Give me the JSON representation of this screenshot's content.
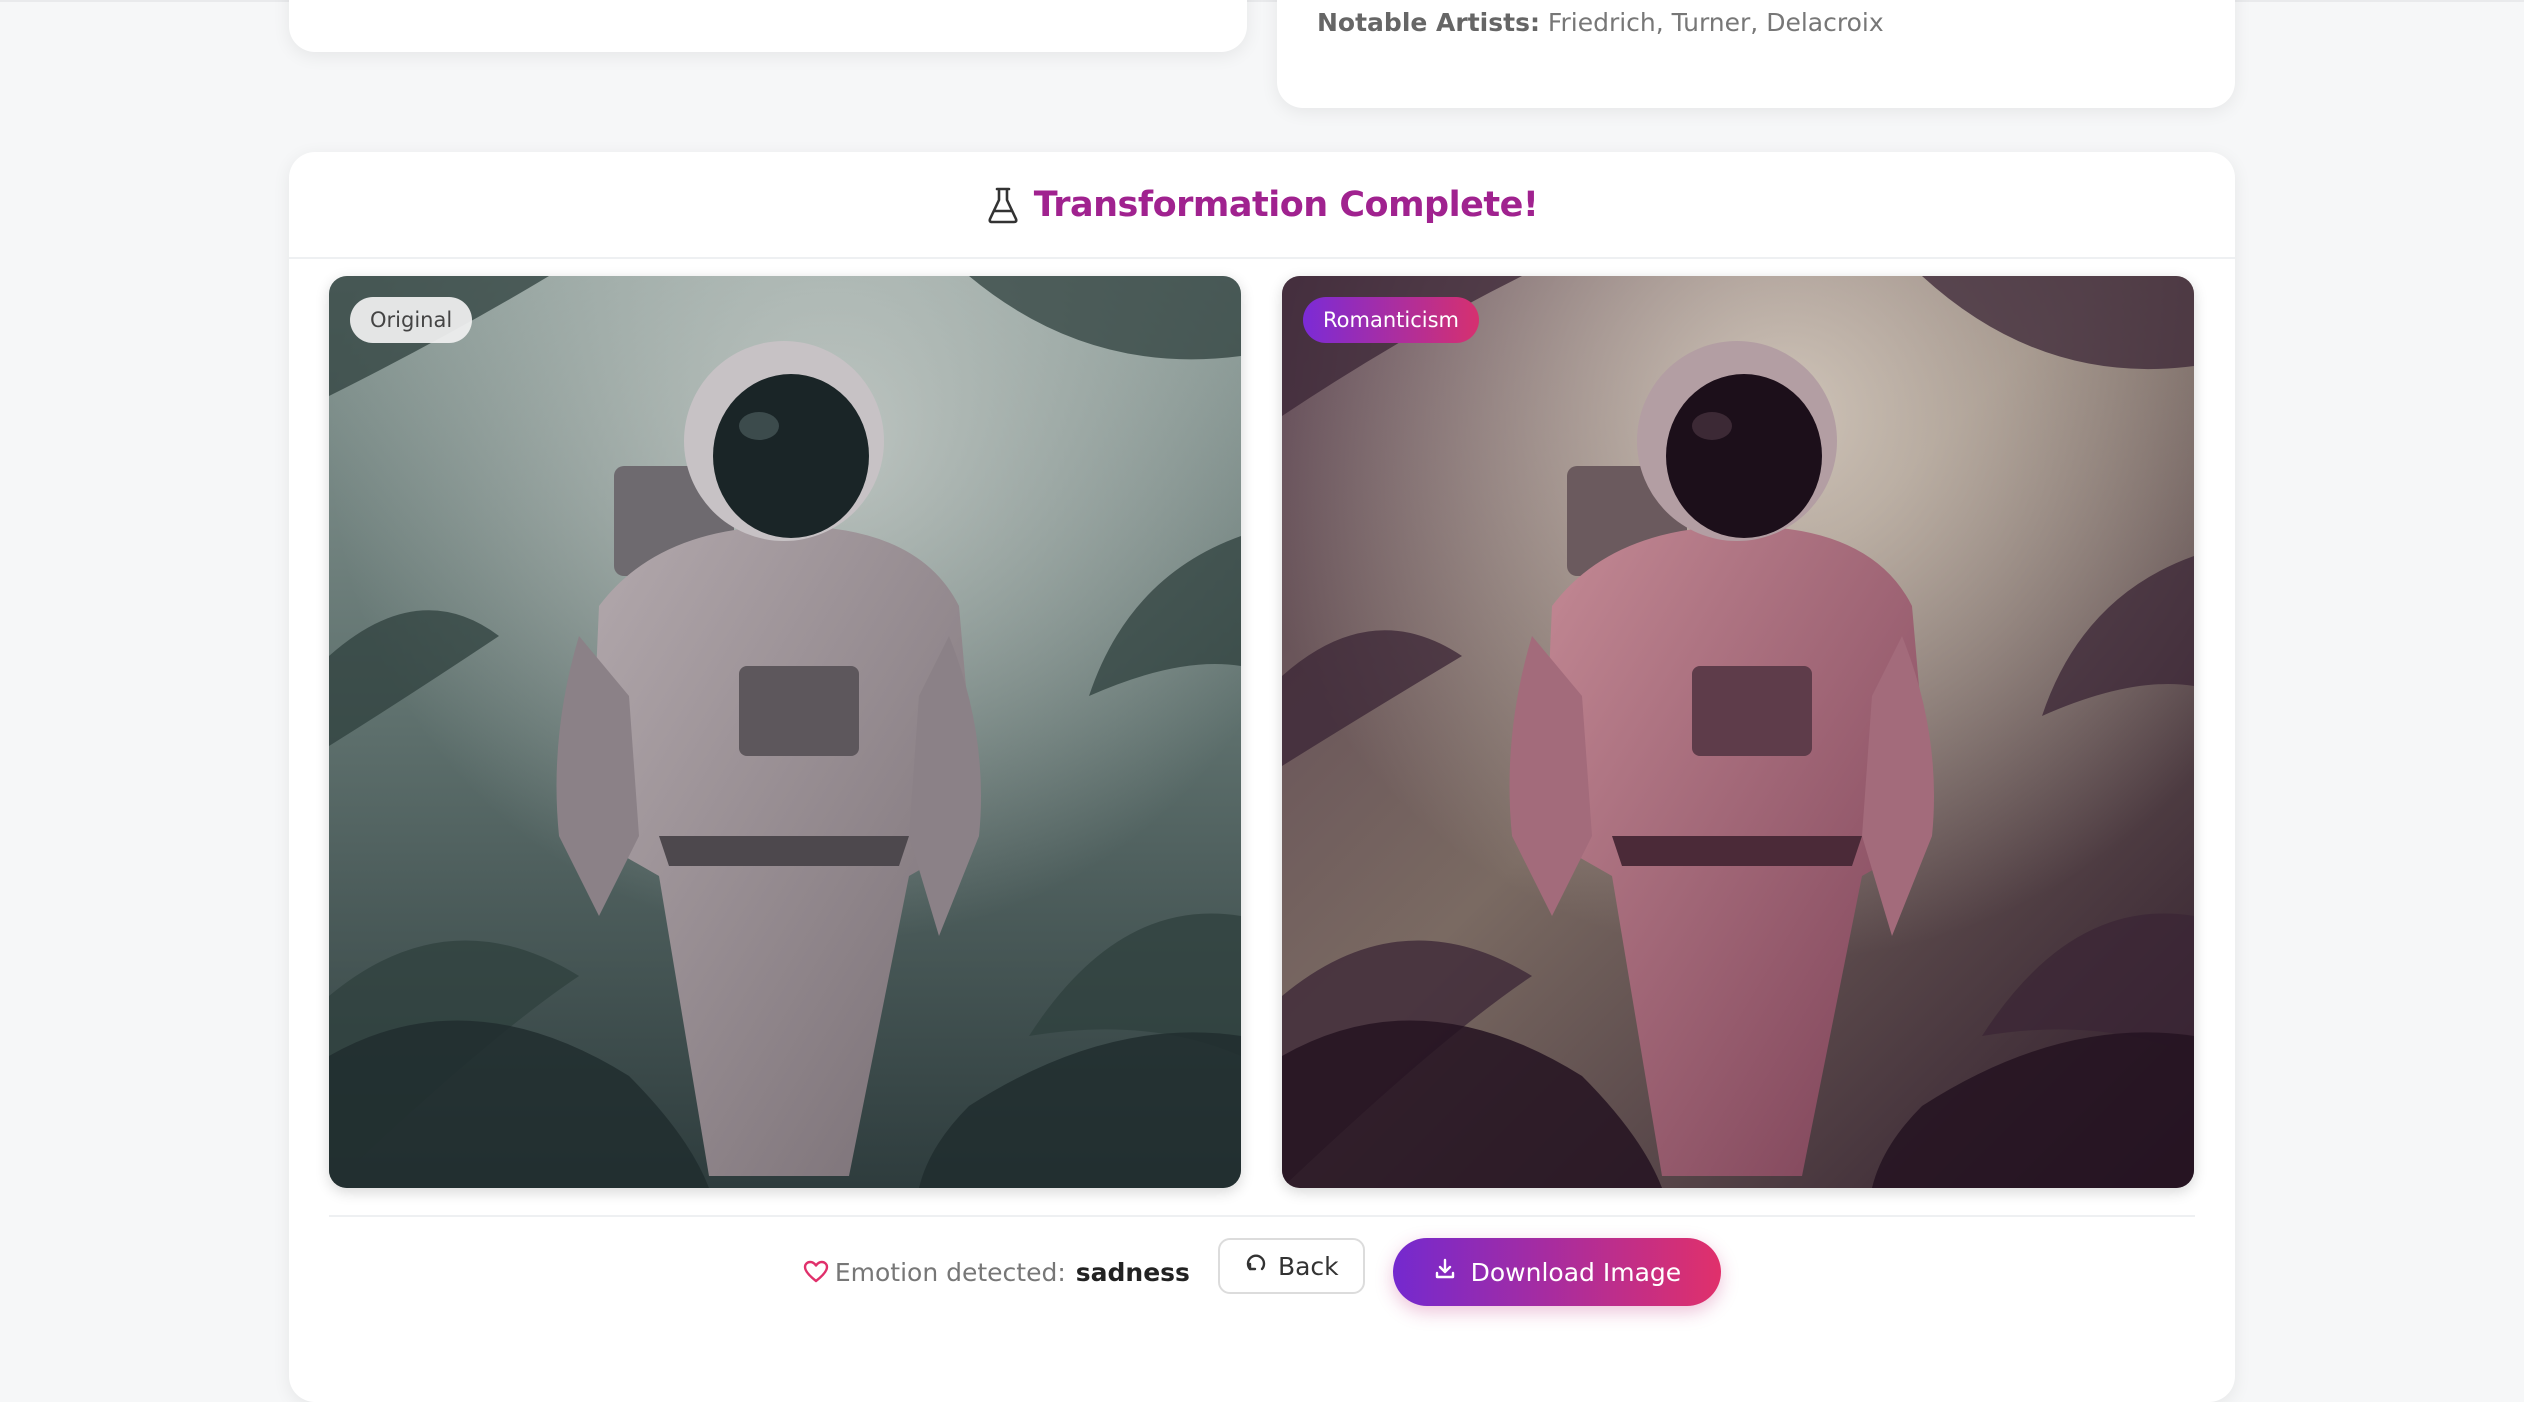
{
  "artists_card": {
    "label": "Notable Artists:",
    "value": "Friedrich, Turner, Delacroix"
  },
  "result": {
    "title": "Transformation Complete!",
    "icon": "flask-icon",
    "original_badge": "Original",
    "style_badge": "Romanticism",
    "emotion_label": "Emotion detected:",
    "emotion_value": "sadness",
    "back_label": "Back",
    "download_label": "Download Image"
  },
  "colors": {
    "accent_title": "#a0228f",
    "gradient_start": "#7429cf",
    "gradient_end": "#e0306b",
    "heart": "#e0306b"
  }
}
